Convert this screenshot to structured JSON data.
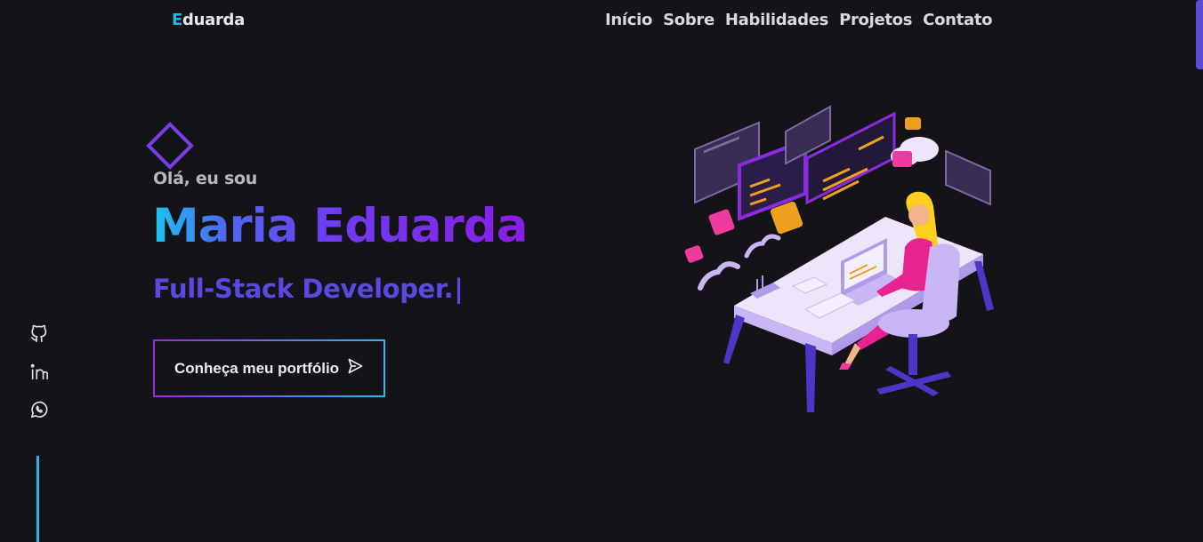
{
  "header": {
    "logo_first": "E",
    "logo_rest": "duarda",
    "nav": [
      "Início",
      "Sobre",
      "Habilidades",
      "Projetos",
      "Contato"
    ]
  },
  "hero": {
    "greeting": "Olá, eu sou",
    "name": "Maria Eduarda",
    "role": "Full-Stack Developer.",
    "cursor": "|",
    "cta_label": "Conheça meu portfólio"
  },
  "socials": {
    "github": "github-icon",
    "linkedin": "linkedin-icon",
    "whatsapp": "whatsapp-icon"
  },
  "colors": {
    "background": "#141318",
    "accent_cyan": "#29b7e6",
    "accent_purple": "#7b3fe8",
    "role_color": "#5b48e0"
  }
}
